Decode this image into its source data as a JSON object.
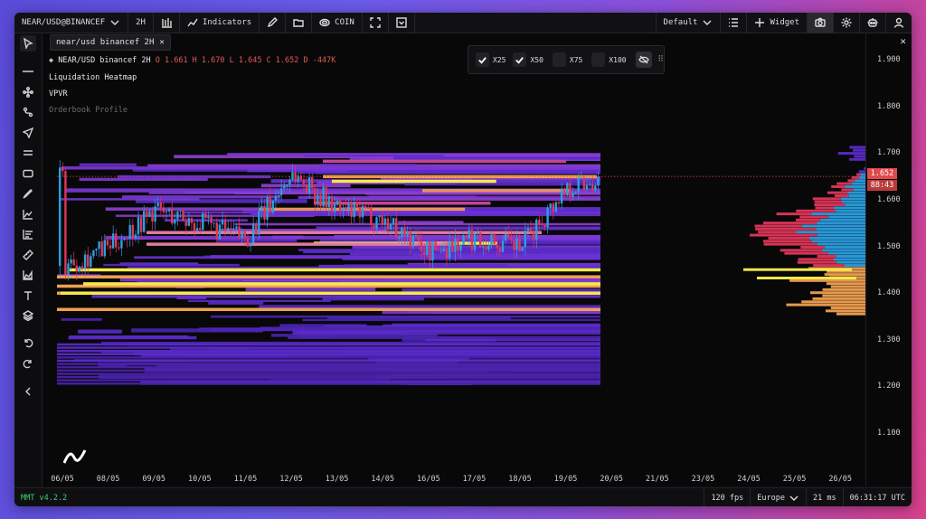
{
  "topbar": {
    "symbol": "NEAR/USD@BINANCEF",
    "timeframe": "2H",
    "indicators_label": "Indicators",
    "coin_label": "COIN",
    "layout_label": "Default",
    "widget_label": "Widget"
  },
  "tab": {
    "label": "near/usd binancef 2H"
  },
  "legend": {
    "pair": "NEAR/USD binancef 2H",
    "ohlc": "O 1.661 H 1.670 L 1.645 C 1.652 D -447K",
    "lines": [
      "Liquidation Heatmap",
      "VPVR",
      "Orderbook Profile"
    ]
  },
  "leverage_filter": {
    "options": [
      {
        "label": "X25",
        "checked": true
      },
      {
        "label": "X50",
        "checked": true
      },
      {
        "label": "X75",
        "checked": false
      },
      {
        "label": "X100",
        "checked": false
      }
    ]
  },
  "y_axis": {
    "ticks": [
      "1.900",
      "1.800",
      "1.700",
      "1.600",
      "1.500",
      "1.400",
      "1.300",
      "1.200",
      "1.100"
    ],
    "last_price": "1.652",
    "countdown": "88:43"
  },
  "x_axis": {
    "ticks": [
      "06/05",
      "08/05",
      "09/05",
      "10/05",
      "11/05",
      "12/05",
      "13/05",
      "14/05",
      "16/05",
      "17/05",
      "18/05",
      "19/05",
      "20/05",
      "21/05",
      "23/05",
      "24/05",
      "25/05",
      "26/05"
    ]
  },
  "status": {
    "version": "MMT v4.2.2",
    "fps": "120 fps",
    "region": "Europe",
    "latency": "21 ms",
    "clock": "06:31:17 UTC"
  },
  "colors": {
    "bull": "#2a9fe0",
    "bear": "#e0365a",
    "heat_low": "#5b2bc9",
    "heat_mid": "#b04ad0",
    "heat_high": "#f0a050",
    "heat_max": "#f5e94a",
    "price_tag": "#e04a4a"
  },
  "chart_data": {
    "type": "candlestick",
    "x_ticks": [
      "06/05",
      "08/05",
      "09/05",
      "10/05",
      "11/05",
      "12/05",
      "13/05",
      "14/05",
      "16/05",
      "17/05",
      "18/05",
      "19/05",
      "20/05",
      "21/05",
      "23/05",
      "24/05",
      "25/05",
      "26/05"
    ],
    "ylim": [
      1.08,
      1.92
    ],
    "last_price": 1.652,
    "ohlc_last": {
      "open": 1.661,
      "high": 1.67,
      "low": 1.645,
      "close": 1.652
    },
    "close_path": [
      {
        "x": "06/05",
        "y": 1.46
      },
      {
        "x": "08/05",
        "y": 1.5
      },
      {
        "x": "09/05",
        "y": 1.58
      },
      {
        "x": "10/05",
        "y": 1.55
      },
      {
        "x": "11/05",
        "y": 1.52
      },
      {
        "x": "12/05",
        "y": 1.66
      },
      {
        "x": "13/05",
        "y": 1.58
      },
      {
        "x": "14/05",
        "y": 1.56
      },
      {
        "x": "16/05",
        "y": 1.49
      },
      {
        "x": "17/05",
        "y": 1.52
      },
      {
        "x": "18/05",
        "y": 1.5
      },
      {
        "x": "19/05",
        "y": 1.63
      },
      {
        "x": "20/05",
        "y": 1.652
      }
    ]
  }
}
